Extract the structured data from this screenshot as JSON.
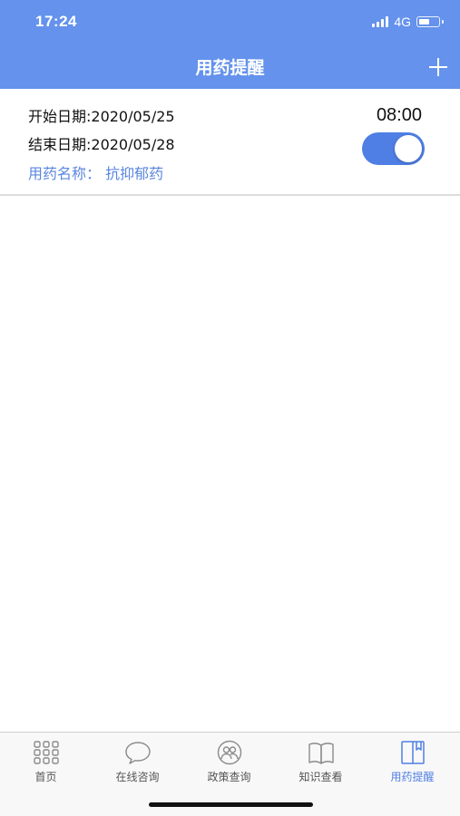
{
  "status_bar": {
    "time": "17:24",
    "network": "4G",
    "battery_level": 0.6
  },
  "header": {
    "title": "用药提醒",
    "add_icon": "plus-icon",
    "background_color": "#6492ec"
  },
  "reminders": [
    {
      "start_date": "开始日期:2020/05/25",
      "end_date": "结束日期:2020/05/28",
      "drug_name": "用药名称： 抗抑郁药",
      "time": "08:00",
      "enabled": true
    }
  ],
  "tabbar": {
    "active_color": "#4f7fe4",
    "tabs": [
      {
        "label": "首页",
        "icon": "grid-icon",
        "active": false
      },
      {
        "label": "在线咨询",
        "icon": "chat-bubble-icon",
        "active": false
      },
      {
        "label": "政策查询",
        "icon": "people-icon",
        "active": false
      },
      {
        "label": "知识查看",
        "icon": "book-icon",
        "active": false
      },
      {
        "label": "用药提醒",
        "icon": "bookmark-book-icon",
        "active": true
      }
    ]
  }
}
